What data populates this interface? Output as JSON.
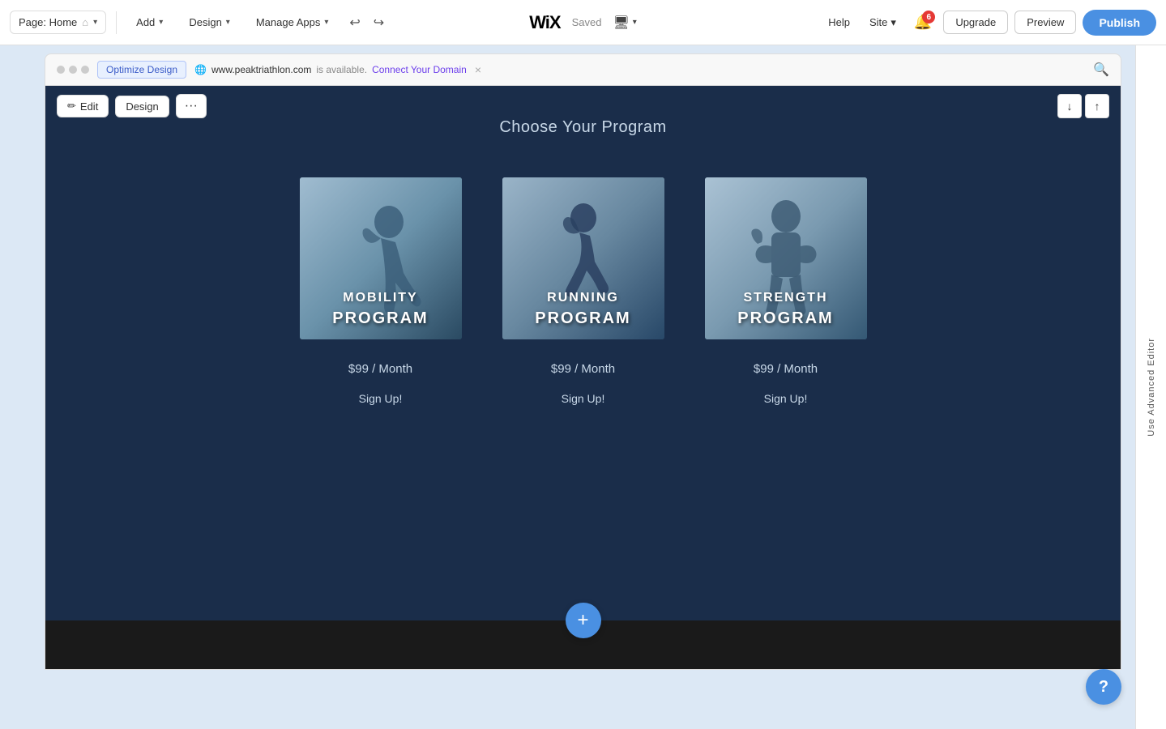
{
  "toolbar": {
    "page_label": "Page: Home",
    "home_icon": "⌂",
    "add_label": "Add",
    "design_label": "Design",
    "manage_apps_label": "Manage Apps",
    "undo_icon": "↩",
    "redo_icon": "↪",
    "wix_logo": "WiX",
    "saved_label": "Saved",
    "device_icon": "🖥",
    "help_label": "Help",
    "site_label": "Site",
    "notifications_count": "6",
    "upgrade_label": "Upgrade",
    "preview_label": "Preview",
    "publish_label": "Publish"
  },
  "browser_bar": {
    "optimize_tab": "Optimize Design",
    "url": "www.peaktriathlon.com",
    "available_text": "is available.",
    "connect_domain_label": "Connect Your Domain",
    "close_icon": "×",
    "search_icon": "🔍"
  },
  "section_toolbar": {
    "edit_icon": "✏",
    "edit_label": "Edit",
    "design_label": "Design",
    "more_icon": "⋯",
    "arrow_down": "↓",
    "arrow_up": "↑"
  },
  "program_section": {
    "title": "Choose Your Program",
    "programs": [
      {
        "id": "mobility",
        "name_line1": "MOBILITY",
        "name_line2": "PROGRAM",
        "price": "$99 / Month",
        "signup": "Sign Up!",
        "bg_color1": "#6b8fa8",
        "bg_color2": "#4a6e8a"
      },
      {
        "id": "running",
        "name_line1": "RUNNING",
        "name_line2": "PROGRAM",
        "price": "$99 / Month",
        "signup": "Sign Up!",
        "bg_color1": "#7a8fa0",
        "bg_color2": "#3a5a70"
      },
      {
        "id": "strength",
        "name_line1": "STRENGTH",
        "name_line2": "PROGRAM",
        "price": "$99 / Month",
        "signup": "Sign Up!",
        "bg_color1": "#8a9fae",
        "bg_color2": "#4a6a7e"
      }
    ],
    "add_section_icon": "+"
  },
  "right_panel": {
    "label": "Use Advanced Editor"
  },
  "help": {
    "icon": "?"
  }
}
